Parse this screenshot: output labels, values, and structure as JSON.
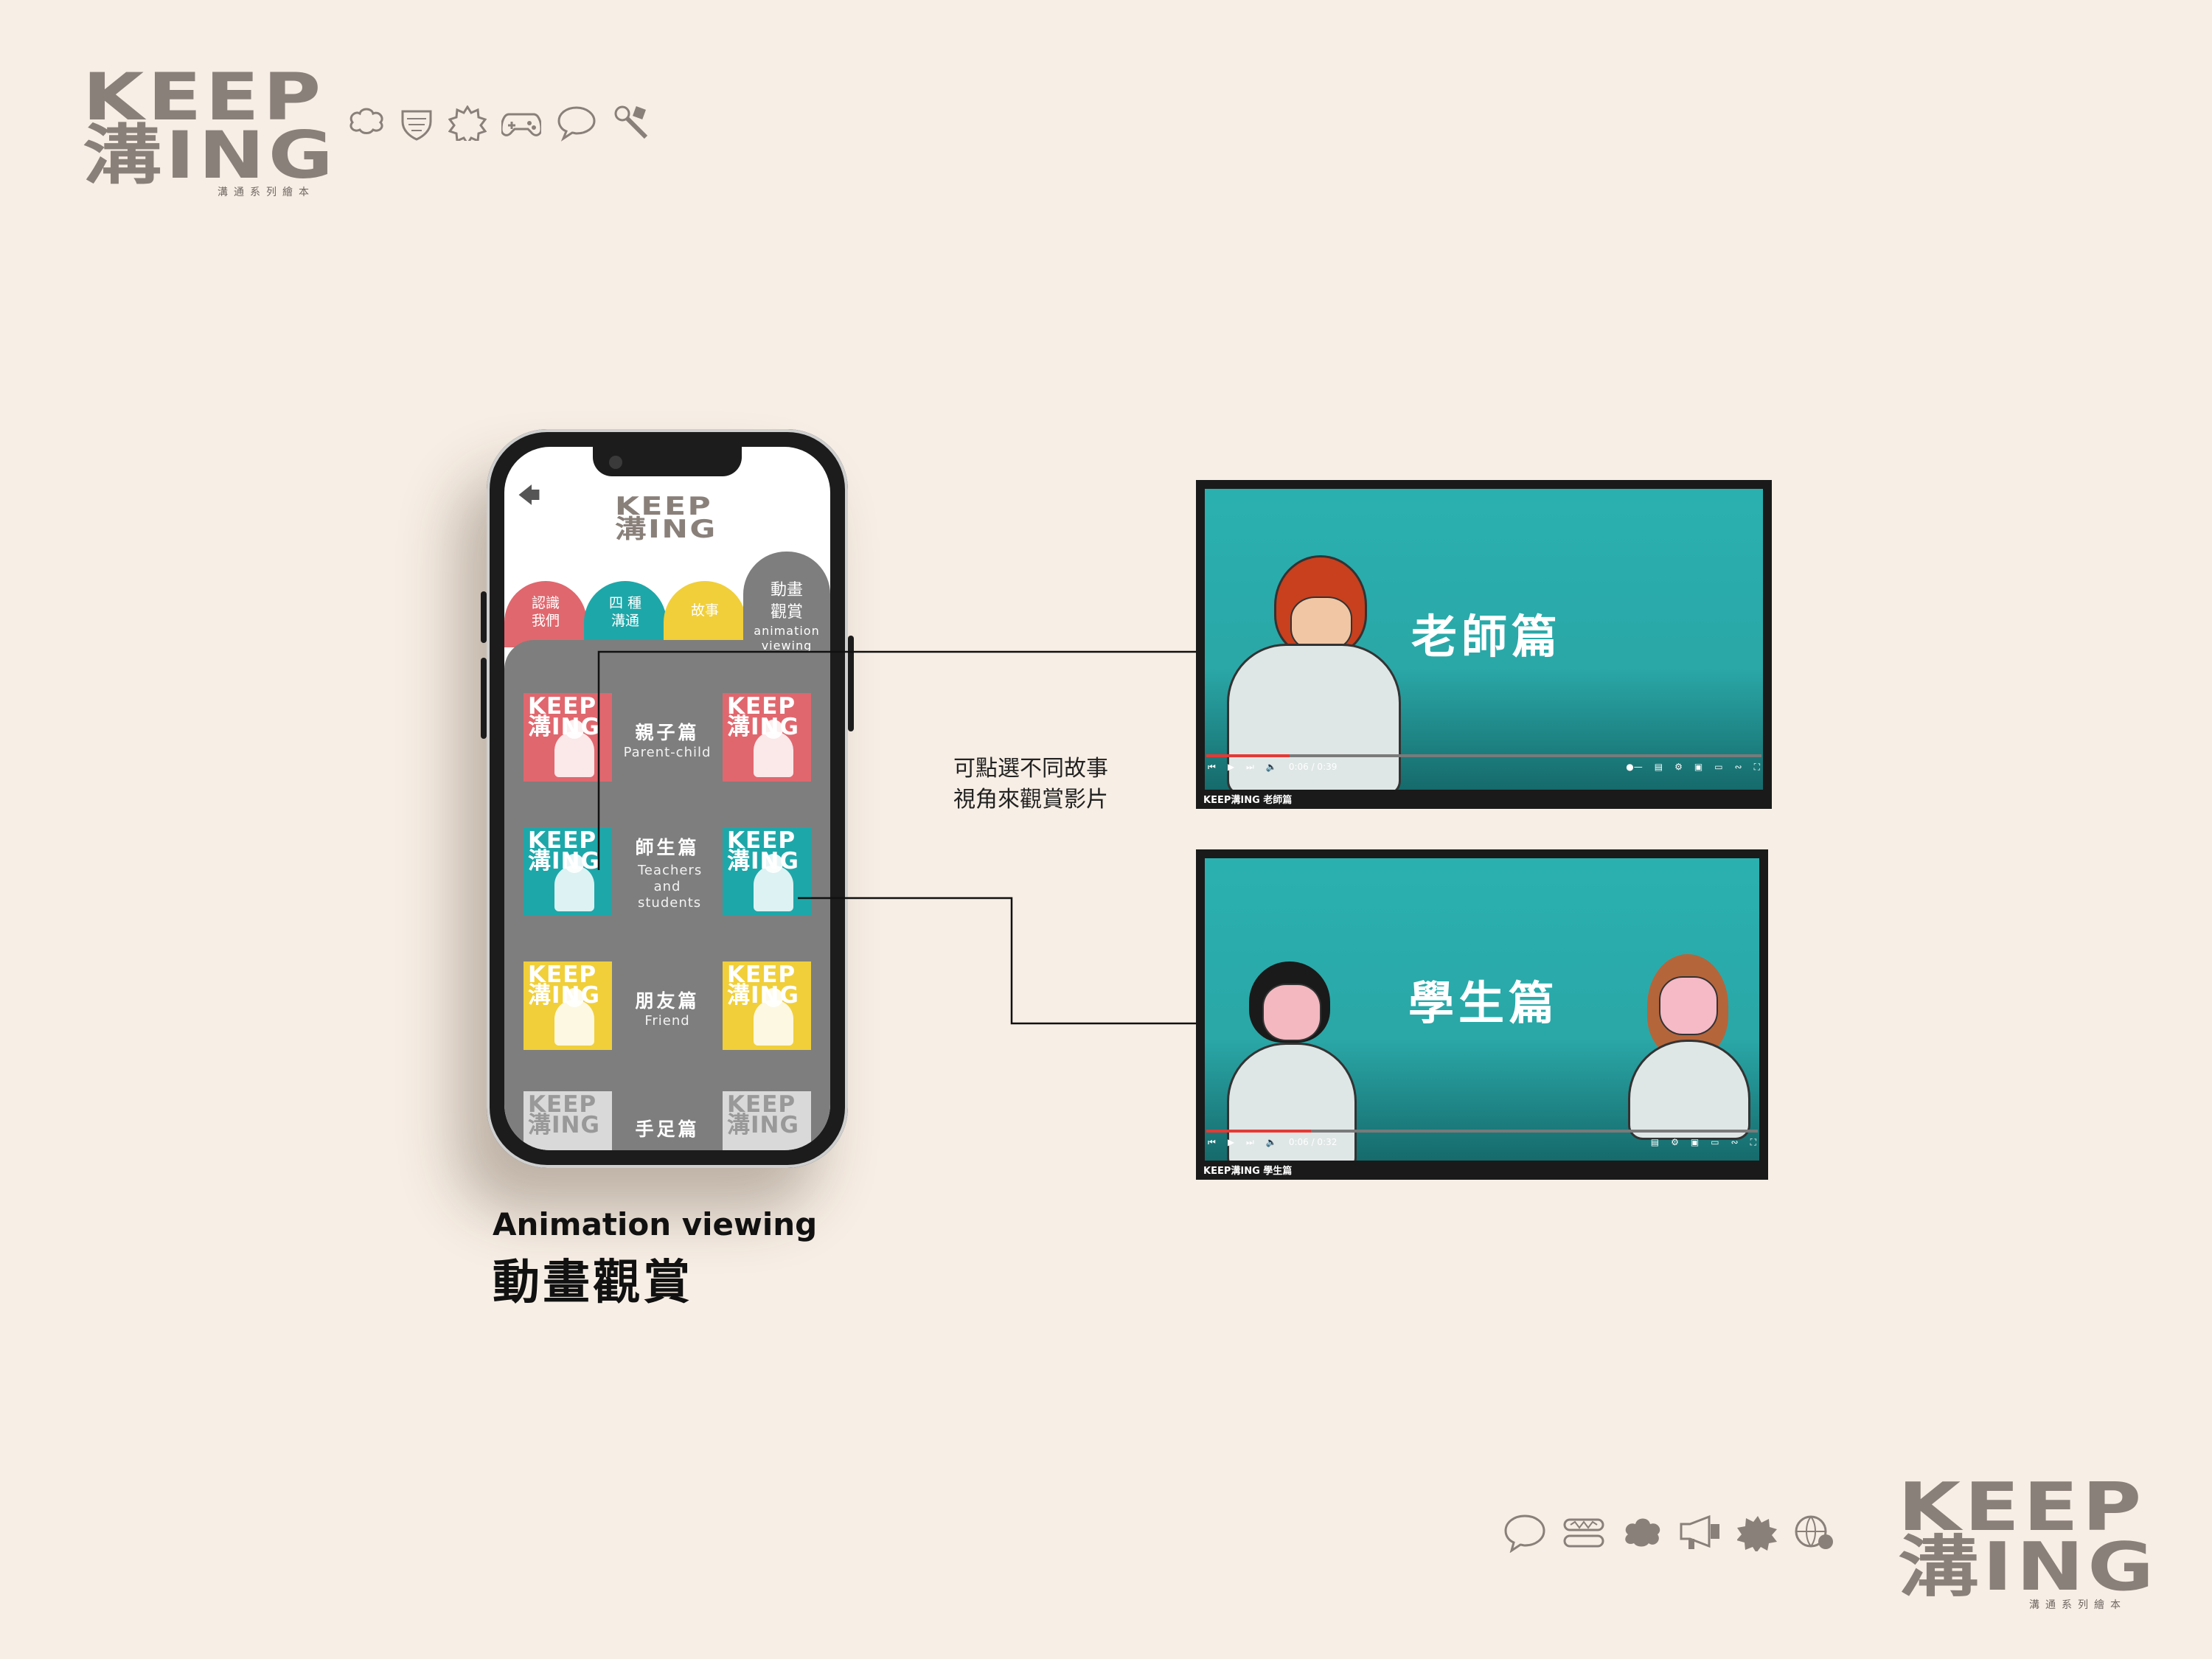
{
  "brand": {
    "logo_line1": "KEEP",
    "logo_line2": "溝ING",
    "logo_sub": "溝通系列繪本"
  },
  "phone_app": {
    "back_icon": "back-arrow-icon",
    "logo_line1": "KEEP",
    "logo_line2": "溝ING",
    "tabs": [
      {
        "label": "認識\n我們",
        "color": "#e0676e"
      },
      {
        "label": "四 種\n溝通",
        "color": "#1ea7a9"
      },
      {
        "label": "故事",
        "color": "#f0cf3a"
      },
      {
        "label": "動畫\n觀賞",
        "sub": "animation viewing",
        "color": "#7e7e7e",
        "active": true
      }
    ],
    "rows": [
      {
        "title": "親子篇",
        "subtitle": "Parent-child",
        "thumb_text": "KEEP溝ING",
        "color": "#e0676e"
      },
      {
        "title": "師生篇",
        "subtitle": "Teachers and students",
        "thumb_text": "KEEP溝ING",
        "color": "#1ea7a9"
      },
      {
        "title": "朋友篇",
        "subtitle": "Friend",
        "thumb_text": "KEEP溝ING",
        "color": "#f0cf3a"
      },
      {
        "title": "手足篇",
        "subtitle": "",
        "thumb_text": "KEEP溝ING",
        "color": "#d9d9d9"
      }
    ]
  },
  "note": "可點選不同故事\n視角來觀賞影片",
  "videos": [
    {
      "title": "老師篇",
      "time": "0:06 / 0:39",
      "caption": "KEEP溝ING 老師篇",
      "progress": 0.15
    },
    {
      "title": "學生篇",
      "time": "0:06 / 0:32",
      "caption": "KEEP溝ING 學生篇",
      "progress": 0.19
    }
  ],
  "caption": {
    "en": "Animation viewing",
    "zh": "動畫觀賞"
  },
  "icons_top": [
    "speech-cloud-icon",
    "shield-bubble-icon",
    "burst-bubble-icon",
    "gamepad-icon",
    "speech-bubble-icon",
    "tools-icon"
  ],
  "icons_bottom": [
    "speech-bubble-icon",
    "wave-bubble-icon",
    "cloud-bubble-icon",
    "megaphone-icon",
    "spiky-bubble-icon",
    "globe-bubble-icon"
  ]
}
